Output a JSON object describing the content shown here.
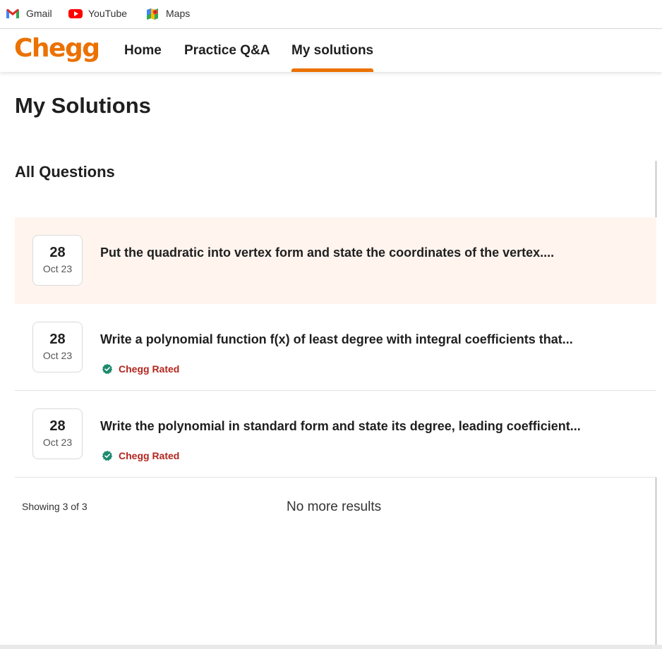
{
  "bookmarks": [
    {
      "label": "Gmail",
      "icon": "gmail-icon"
    },
    {
      "label": "YouTube",
      "icon": "youtube-icon"
    },
    {
      "label": "Maps",
      "icon": "maps-icon"
    }
  ],
  "header": {
    "logo": "Chegg",
    "nav": [
      {
        "label": "Home"
      },
      {
        "label": "Practice Q&A"
      },
      {
        "label": "My solutions",
        "active": true
      }
    ],
    "accent_color": "#eb7100"
  },
  "page": {
    "title": "My Solutions",
    "section_title": "All Questions"
  },
  "questions": [
    {
      "day": "28",
      "month": "Oct 23",
      "text": "Put the quadratic into vertex form and state the coordinates of the vertex....",
      "badge": null,
      "highlighted": true
    },
    {
      "day": "28",
      "month": "Oct 23",
      "text": "Write a polynomial function f(x) of least degree with integral coefficients that...",
      "badge": "Chegg Rated",
      "highlighted": false
    },
    {
      "day": "28",
      "month": "Oct 23",
      "text": "Write the polynomial in standard form and state its degree, leading coefficient...",
      "badge": "Chegg Rated",
      "highlighted": false
    }
  ],
  "footer": {
    "showing": "Showing 3 of 3",
    "no_more": "No more results"
  },
  "colors": {
    "highlight_row": "#fff4ee",
    "badge_text": "#b3261e",
    "badge_icon": "#1e8a6e"
  }
}
